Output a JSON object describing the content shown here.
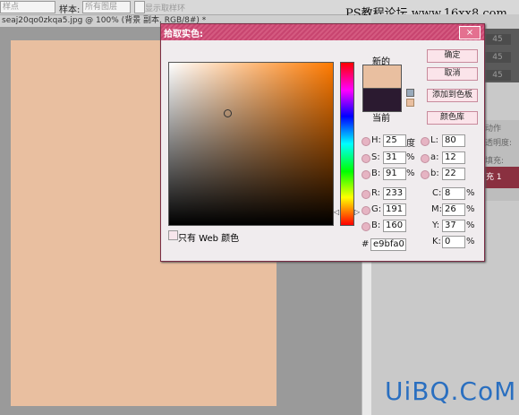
{
  "optionsBar": {
    "sample_dropdown": "样点",
    "sample_label": "样本:",
    "sample_value": "所有图层",
    "show_ring": "显示取样环"
  },
  "docTab": "seaj20qo0zkqa5.jpg @ 100% (背景 副本, RGB/8#) *",
  "watermarkTop": "PS教程论坛 www.16xx8.com",
  "watermarkBottom": "UiBQ.CoM",
  "swatchValues": [
    "45",
    "45",
    "45"
  ],
  "panelLabels": {
    "opacity_label": "透明度:",
    "fill_label": "填充:",
    "layer_label": "充 1",
    "tabs": "动作"
  },
  "dialog": {
    "title": "拾取实色:",
    "close": "×",
    "new_label": "新的",
    "current_label": "当前",
    "buttons": {
      "ok": "确定",
      "cancel": "取消",
      "add_swatch": "添加到色板",
      "color_library": "颜色库"
    },
    "web_only": "只有 Web 颜色",
    "hue_left": "◁",
    "hue_right": "▷",
    "fields": {
      "H": "25",
      "S": "31",
      "Bv": "91",
      "R": "233",
      "G": "191",
      "B": "160",
      "L": "80",
      "a": "12",
      "b": "22",
      "C": "8",
      "M": "26",
      "Y": "37",
      "K": "0",
      "hex": "e9bfa0"
    },
    "labels": {
      "H": "H:",
      "S": "S:",
      "Bv": "B:",
      "R": "R:",
      "G": "G:",
      "B": "B:",
      "L": "L:",
      "a": "a:",
      "b": "b:",
      "C": "C:",
      "M": "M:",
      "Y": "Y:",
      "K": "K:",
      "hash": "#"
    },
    "units": {
      "deg": "度",
      "pct": "%"
    }
  },
  "colors": {
    "new": "#e9bfa0",
    "current": "#2b1a30",
    "canvas": "#e9bfa0",
    "accent": "#c84570"
  }
}
